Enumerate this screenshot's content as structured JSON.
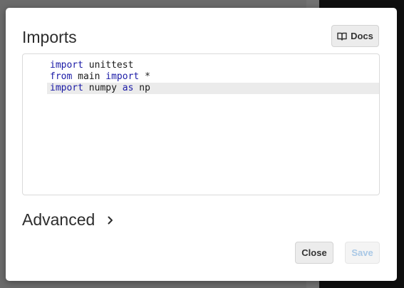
{
  "dialog": {
    "title": "Imports",
    "docs_button": {
      "label": "Docs",
      "icon": "book-open-icon"
    },
    "editor": {
      "lines": [
        {
          "tokens": [
            {
              "text": "import",
              "kw": true
            },
            {
              "text": " unittest",
              "kw": false
            }
          ]
        },
        {
          "tokens": [
            {
              "text": "from",
              "kw": true
            },
            {
              "text": " main ",
              "kw": false
            },
            {
              "text": "import",
              "kw": true
            },
            {
              "text": " *",
              "kw": false
            }
          ]
        },
        {
          "tokens": [
            {
              "text": "import",
              "kw": true
            },
            {
              "text": " numpy ",
              "kw": false
            },
            {
              "text": "as",
              "kw": true
            },
            {
              "text": " np",
              "kw": false
            }
          ]
        }
      ],
      "active_line": 3
    },
    "advanced": {
      "label": "Advanced",
      "icon": "chevron-right-icon"
    },
    "close_button": {
      "label": "Close"
    },
    "save_button": {
      "label": "Save",
      "disabled": true
    }
  },
  "colors": {
    "keyword": "#1a1aa6",
    "save_disabled_text": "#a9c8e6"
  }
}
